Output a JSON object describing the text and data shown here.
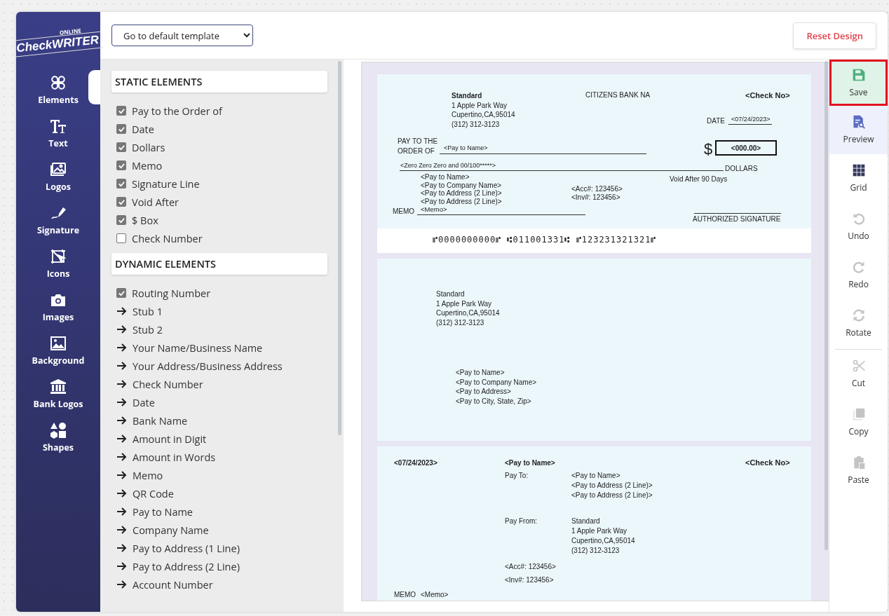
{
  "sidebar": {
    "logo": {
      "tagline": "ONLINE",
      "name": "CheckWRITER"
    },
    "items": [
      {
        "label": "Elements",
        "selected": true
      },
      {
        "label": "Text",
        "selected": false
      },
      {
        "label": "Logos",
        "selected": false
      },
      {
        "label": "Signature",
        "selected": false
      },
      {
        "label": "Icons",
        "selected": false
      },
      {
        "label": "Images",
        "selected": false
      },
      {
        "label": "Background",
        "selected": false
      },
      {
        "label": "Bank Logos",
        "selected": false
      },
      {
        "label": "Shapes",
        "selected": false
      }
    ]
  },
  "top_bar": {
    "template_select": {
      "value": "Go to default template"
    },
    "reset_button": "Reset Design"
  },
  "elements_panel": {
    "sections": [
      {
        "title": "STATIC ELEMENTS",
        "items": [
          {
            "kind": "checkbox",
            "label": "Pay to the Order of",
            "checked": true
          },
          {
            "kind": "checkbox",
            "label": "Date",
            "checked": true
          },
          {
            "kind": "checkbox",
            "label": "Dollars",
            "checked": true
          },
          {
            "kind": "checkbox",
            "label": "Memo",
            "checked": true
          },
          {
            "kind": "checkbox",
            "label": "Signature Line",
            "checked": true
          },
          {
            "kind": "checkbox",
            "label": "Void After",
            "checked": true
          },
          {
            "kind": "checkbox",
            "label": "$ Box",
            "checked": true
          },
          {
            "kind": "checkbox",
            "label": "Check Number",
            "checked": false
          }
        ]
      },
      {
        "title": "DYNAMIC ELEMENTS",
        "items": [
          {
            "kind": "checkbox",
            "label": "Routing Number",
            "checked": true
          },
          {
            "kind": "arrow",
            "label": "Stub 1"
          },
          {
            "kind": "arrow",
            "label": "Stub 2"
          },
          {
            "kind": "arrow",
            "label": "Your Name/Business Name"
          },
          {
            "kind": "arrow",
            "label": "Your Address/Business Address"
          },
          {
            "kind": "arrow",
            "label": "Check Number"
          },
          {
            "kind": "arrow",
            "label": "Date"
          },
          {
            "kind": "arrow",
            "label": "Bank Name"
          },
          {
            "kind": "arrow",
            "label": "Amount in Digit"
          },
          {
            "kind": "arrow",
            "label": "Amount in Words"
          },
          {
            "kind": "arrow",
            "label": "Memo"
          },
          {
            "kind": "arrow",
            "label": "QR Code"
          },
          {
            "kind": "arrow",
            "label": "Pay to Name"
          },
          {
            "kind": "arrow",
            "label": "Company Name"
          },
          {
            "kind": "arrow",
            "label": "Pay to Address (1 Line)"
          },
          {
            "kind": "arrow",
            "label": "Pay to Address (2 Line)"
          },
          {
            "kind": "arrow",
            "label": "Account Number"
          }
        ]
      }
    ]
  },
  "check": {
    "company": [
      "Standard",
      "1 Apple Park Way",
      "Cupertino,CA,95014",
      "(312) 312-3123"
    ],
    "bank_name": "CITIZENS BANK NA",
    "check_no": "<Check No>",
    "date_label": "DATE",
    "date": "<07/24/2023>",
    "pay_to_label": [
      "PAY TO THE",
      "ORDER OF"
    ],
    "payee": "<Pay to Name>",
    "currency": "$",
    "amount": "<000.00>",
    "amount_words": "<Zero Zero Zero and 00/100*****>",
    "dollars_label": "DOLLARS",
    "payee_address": [
      "<Pay to Name>",
      "<Pay to Company Name>",
      "<Pay to Address (2 Line)>",
      "<Pay to Address (2 Line)>"
    ],
    "void_after": "Void After 90 Days",
    "references": [
      "<Acc#: 123456>",
      "<Inv#: 123456>"
    ],
    "memo_label": "MEMO",
    "memo": "<Memo>",
    "signature_label": "AUTHORIZED SIGNATURE",
    "micr": "⑈0000000000⑈ ⑆011001331⑆ ⑈123231321321⑈"
  },
  "mailing_stub": {
    "sender": [
      "Standard",
      "1 Apple Park Way",
      "Cupertino,CA,95014",
      "(312) 312-3123"
    ],
    "recipient": [
      "<Pay to Name>",
      "<Pay to Company Name>",
      "<Pay to Address>",
      "<Pay to City, State, Zip>"
    ]
  },
  "voucher_stub": {
    "date": "<07/24/2023>",
    "payee": "<Pay to Name>",
    "check_no": "<Check No>",
    "pay_to_label": "Pay To:",
    "pay_to": [
      "<Pay to Name>",
      "<Pay to Address (2 Line)>",
      "<Pay to Address (2 Line)>"
    ],
    "pay_from_label": "Pay From:",
    "pay_from": [
      "Standard",
      "1 Apple Park Way",
      "Cupertino,CA,95014",
      "(312) 312-3123"
    ],
    "references": [
      "<Acc#: 123456>",
      "<Inv#: 123456>"
    ],
    "memo_label": "MEMO",
    "memo": "<Memo>"
  },
  "tool_groups": [
    [
      {
        "label": "Save",
        "highlighted": true,
        "active": false,
        "disabled": false
      },
      {
        "label": "Preview",
        "highlighted": false,
        "active": true,
        "disabled": false
      },
      {
        "label": "Grid",
        "highlighted": false,
        "active": false,
        "disabled": false
      },
      {
        "label": "Undo",
        "highlighted": false,
        "active": false,
        "disabled": true
      },
      {
        "label": "Redo",
        "highlighted": false,
        "active": false,
        "disabled": true
      },
      {
        "label": "Rotate",
        "highlighted": false,
        "active": false,
        "disabled": true
      }
    ],
    [
      {
        "label": "Cut",
        "highlighted": false,
        "active": false,
        "disabled": true
      },
      {
        "label": "Copy",
        "highlighted": false,
        "active": false,
        "disabled": true
      },
      {
        "label": "Paste",
        "highlighted": false,
        "active": false,
        "disabled": true
      }
    ]
  ]
}
